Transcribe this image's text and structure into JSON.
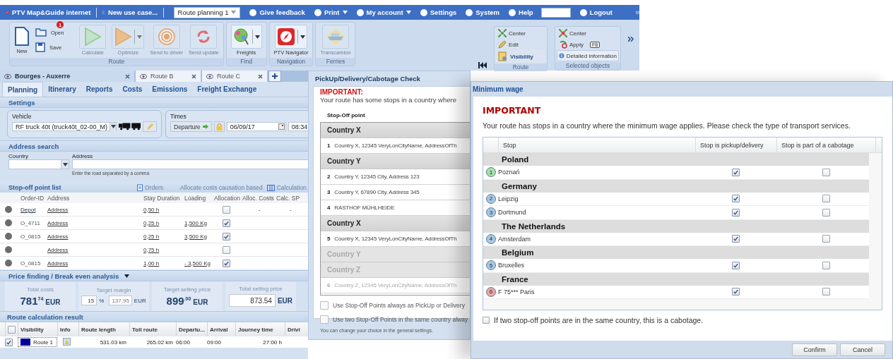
{
  "app": {
    "top_bar": {
      "logo": "PTV Map&Guide internet",
      "new_use_case": "New use case...",
      "route_select": "Route planning 1",
      "links": [
        {
          "label": "Give feedback",
          "caret": false
        },
        {
          "label": "Print",
          "caret": true
        },
        {
          "label": "My account",
          "caret": true
        },
        {
          "label": "Settings",
          "caret": false
        },
        {
          "label": "System",
          "caret": false
        },
        {
          "label": "Help",
          "caret": false
        }
      ],
      "logout": "Logout"
    },
    "ribbon": {
      "groups": [
        {
          "label": "Route",
          "items": [
            {
              "kind": "big",
              "label": "New"
            },
            {
              "kind": "small",
              "label": "Open",
              "badge": "1"
            },
            {
              "kind": "small",
              "label": "Save"
            },
            {
              "kind": "tile",
              "label": "Calculate",
              "disabled": true,
              "dropdown": false
            },
            {
              "kind": "tile",
              "label": "Optimize",
              "disabled": true,
              "dropdown": true
            },
            {
              "kind": "tile",
              "label": "Send to driver",
              "disabled": true,
              "dropdown": false
            },
            {
              "kind": "tile",
              "label": "Send update",
              "disabled": true,
              "dropdown": false
            }
          ]
        },
        {
          "label": "Find",
          "items": [
            {
              "kind": "tile",
              "label": "Freights",
              "disabled": false,
              "dropdown": true
            }
          ]
        },
        {
          "label": "Navigation",
          "items": [
            {
              "kind": "tile",
              "label": "PTV Navigator",
              "disabled": false,
              "dropdown": true
            }
          ]
        },
        {
          "label": "Ferries",
          "items": [
            {
              "kind": "tile",
              "label": "Transcamion",
              "disabled": true,
              "dropdown": false
            }
          ]
        }
      ],
      "side_groups": [
        {
          "label": "Route",
          "items": [
            {
              "label": "Center",
              "selected": false
            },
            {
              "label": "Edit",
              "selected": false
            },
            {
              "label": "Visibility",
              "selected": true
            }
          ]
        },
        {
          "label": "Selected objects",
          "items": [
            {
              "label": "Center",
              "selected": false
            },
            {
              "label": "Apply",
              "shortcut": "F8",
              "selected": false
            },
            {
              "label": "Detailed information",
              "selected": true
            }
          ]
        }
      ]
    },
    "route_tabs": [
      {
        "label": "Bourges - Auxerre",
        "selected": true
      },
      {
        "label": "Route B",
        "selected": false
      },
      {
        "label": "Route C",
        "selected": false
      }
    ],
    "section_tabs": [
      {
        "label": "Planning",
        "selected": true
      },
      {
        "label": "Itinerary",
        "selected": false
      },
      {
        "label": "Reports",
        "selected": false
      },
      {
        "label": "Costs",
        "selected": false
      },
      {
        "label": "Emissions",
        "selected": false
      },
      {
        "label": "Freight Exchange",
        "selected": false
      }
    ],
    "settings": {
      "title": "Settings",
      "vehicle_label": "Vehicle",
      "vehicle": "RF truck 40t (truck40t_02-00_M)",
      "times_label": "Times",
      "departure_button": "Departure",
      "date": "06/09/17",
      "time": "08:34"
    },
    "address_search": {
      "title": "Address search",
      "country_label": "Country",
      "address_label": "Address",
      "hint": "Enter the road separated by a comma"
    },
    "stop_list": {
      "title": "Stop-off point list",
      "orders": "Orders",
      "allocate": "Allocate costs causation based",
      "calculation": "Calculation",
      "columns": [
        "Order-ID",
        "Address",
        "Stay Duration",
        "Loading",
        "Allocation",
        "Alloc. Costs",
        "Calc. SP"
      ],
      "rows": [
        {
          "order_id": "Depot",
          "order_link": true,
          "address": "Address",
          "stay": "0,50 h",
          "loading": "",
          "allocation": false,
          "alloc_costs": "-",
          "calc_sp": "-"
        },
        {
          "order_id": "O_4711",
          "order_link": false,
          "address": "Address",
          "stay": "0,25 h",
          "loading": "1,500 Kg",
          "allocation": true,
          "alloc_costs": "",
          "calc_sp": ""
        },
        {
          "order_id": "O_0815",
          "order_link": false,
          "address": "Address",
          "stay": "0,25 h",
          "loading": "3,500 Kg",
          "allocation": true,
          "alloc_costs": "",
          "calc_sp": ""
        },
        {
          "order_id": "",
          "address": "Address",
          "stay": "0,75 h",
          "loading": "",
          "allocation": false,
          "alloc_costs": "",
          "calc_sp": ""
        },
        {
          "order_id": "O_0815",
          "order_link": false,
          "address": "Address",
          "stay": "1,00 h",
          "loading": "- 3,500 Kg",
          "allocation": true,
          "alloc_costs": "",
          "calc_sp": ""
        }
      ]
    },
    "price_finding": {
      "title": "Price finding / Break even analysis",
      "cards": [
        {
          "kind": "amount",
          "label": "Total costs",
          "amount": "781$^{74}$",
          "currency": "EUR"
        },
        {
          "kind": "margin",
          "label": "Target margin",
          "percent": "15",
          "percent_unit": "%",
          "value": "137,95",
          "currency": "EUR"
        },
        {
          "kind": "amount",
          "label": "Target selling price",
          "amount": "899$^{.00}$",
          "currency": "EUR"
        },
        {
          "kind": "input",
          "label": "Total selling price",
          "value": "873.54",
          "currency": "EUR"
        }
      ]
    },
    "route_result": {
      "title": "Route calculation result",
      "columns": [
        "Visibility",
        "Info",
        "Route length",
        "Toll route",
        "Departu...",
        "Arrival",
        "Journey time",
        "Drivi"
      ],
      "select_all": false,
      "rows": [
        {
          "checked": true,
          "color": "#00009c",
          "name": "Route 1",
          "route_length": "531.03 km",
          "toll_route": "265.02 km",
          "departure": "06:00",
          "arrival": "09:00",
          "journey_time": "27:00 h"
        }
      ]
    }
  },
  "pickup_dialog": {
    "title": "PickUp/Delivery/Cabotage Check",
    "important": "IMPORTANT:",
    "message": "Your route has some stops in a country where",
    "column": "Stop-Off point",
    "items": [
      {
        "kind": "country",
        "label": "Country X",
        "disabled": false
      },
      {
        "kind": "stop",
        "number": "1",
        "label": "Country X, 12345 VeryLonCityName, AddressOfTh",
        "disabled": false
      },
      {
        "kind": "country",
        "label": "Country Y",
        "disabled": false
      },
      {
        "kind": "stop",
        "number": "2",
        "label": "Country Y, 12345 City, Address 123",
        "disabled": false
      },
      {
        "kind": "stop",
        "number": "3",
        "label": "Country Y, 67890 City, Address 345",
        "disabled": false
      },
      {
        "kind": "stop",
        "number": "4",
        "label": "RASTHOF MÜHLHEIDE",
        "disabled": false
      },
      {
        "kind": "country",
        "label": "Country X",
        "disabled": false
      },
      {
        "kind": "stop",
        "number": "5",
        "label": "Country X, 12345 VeryLonCityName, AddressOfTh",
        "disabled": false
      },
      {
        "kind": "country",
        "label": "Country Y",
        "disabled": true
      },
      {
        "kind": "country",
        "label": "Country Z",
        "disabled": true
      },
      {
        "kind": "stop",
        "number": "6",
        "label": "Country Z, 12345 VeryLonCityName, AddressOfTh",
        "disabled": true
      }
    ],
    "options": [
      {
        "label": "Use Stop-Off Points always as PickUp or Delivery",
        "checked": false
      },
      {
        "label": "Use two Stop-Off Points in the same country alway",
        "checked": false
      }
    ],
    "note": "You can change your choice in the general settings."
  },
  "wage_dialog": {
    "title": "Minimum wage",
    "important": "IMPORTANT",
    "message": "Your route has stops in a country where the minimum wage applies. Please check the type of transport services.",
    "columns": [
      "Stop",
      "Stop is pickup/delivery",
      "Stop is part of a cabotage"
    ],
    "groups": [
      {
        "country": "Poland",
        "stops": [
          {
            "number": "1",
            "color": "#a6e0a6",
            "name": "Poznań",
            "pickup": true,
            "cabotage": false
          }
        ]
      },
      {
        "country": "Germany",
        "stops": [
          {
            "number": "2",
            "color": "#a9c8e0",
            "name": "Leipzig",
            "pickup": true,
            "cabotage": false
          },
          {
            "number": "3",
            "color": "#a9c8e0",
            "name": "Dortmund",
            "pickup": true,
            "cabotage": false
          }
        ]
      },
      {
        "country": "The Netherlands",
        "stops": [
          {
            "number": "4",
            "color": "#a9c8e0",
            "name": "Amsterdam",
            "pickup": true,
            "cabotage": false
          }
        ]
      },
      {
        "country": "Belgium",
        "stops": [
          {
            "number": "5",
            "color": "#a9c8e0",
            "name": "Bruxelles",
            "pickup": true,
            "cabotage": false
          }
        ]
      },
      {
        "country": "France",
        "stops": [
          {
            "number": "6",
            "color": "#eca5a5",
            "name": "F 75*** Paris",
            "pickup": true,
            "cabotage": false
          }
        ]
      }
    ],
    "cabotage_option": {
      "label": "If two stop-off points are in the same country, this is a cabotage.",
      "checked": false
    },
    "buttons": [
      "Confirm",
      "Cancel"
    ]
  }
}
